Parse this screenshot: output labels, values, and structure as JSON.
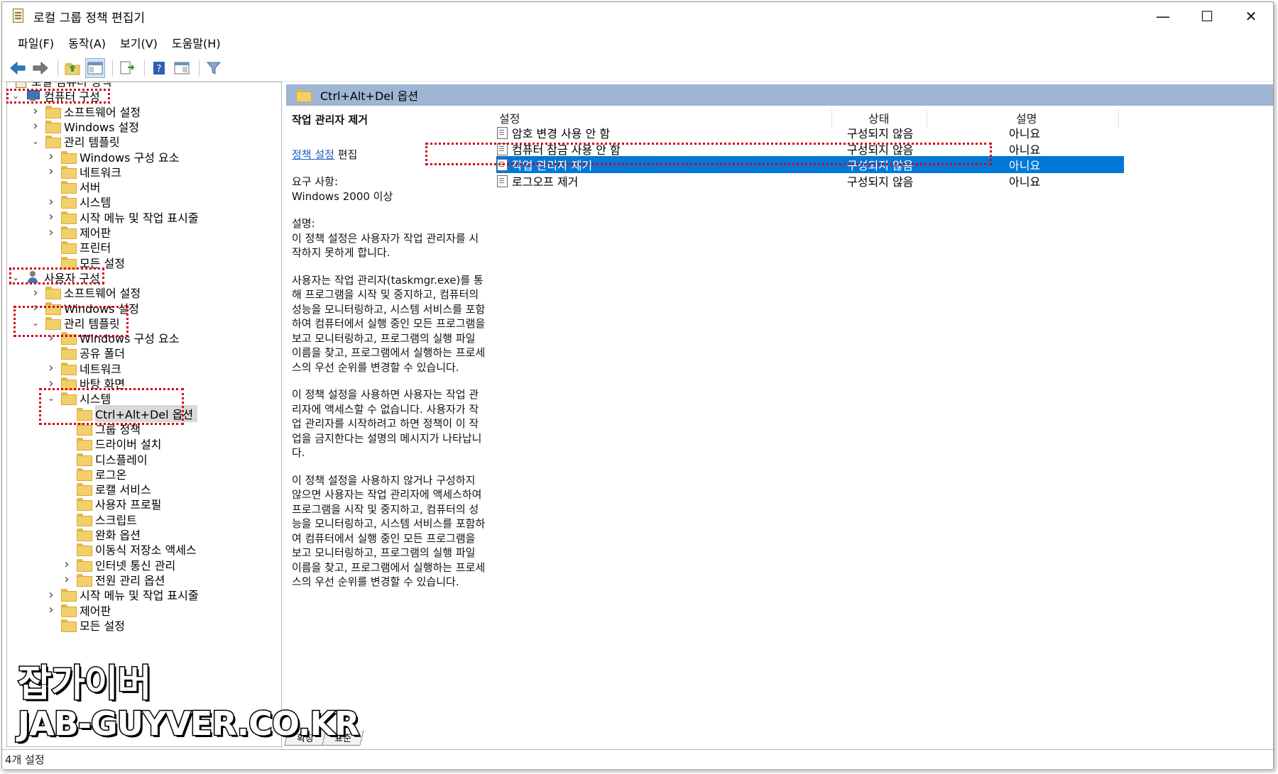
{
  "window": {
    "title": "로컬 그룹 정책 편집기",
    "controls": {
      "minimize": "—",
      "maximize": "☐",
      "close": "✕"
    }
  },
  "menu": [
    "파일(F)",
    "동작(A)",
    "보기(V)",
    "도움말(H)"
  ],
  "toolbar": {
    "icons": [
      "back-arrow-icon",
      "forward-arrow-icon",
      "up-folder-icon",
      "show-hide-tree-icon",
      "export-list-icon",
      "help-icon",
      "properties-icon",
      "filter-icon"
    ]
  },
  "tree": {
    "root": "로컬 컴퓨터 정책",
    "items": [
      "컴퓨터 구성",
      "소프트웨어 설정",
      "Windows 설정",
      "관리 템플릿",
      "Windows 구성 요소",
      "네트워크",
      "서버",
      "시스템",
      "시작 메뉴 및 작업 표시줄",
      "제어판",
      "프린터",
      "모든 설정",
      "사용자 구성",
      "소프트웨어 설정",
      "Windows 설정",
      "관리 템플릿",
      "Windows 구성 요소",
      "공유 폴더",
      "네트워크",
      "바탕 화면",
      "시스템",
      "Ctrl+Alt+Del 옵션",
      "그룹 정책",
      "드라이버 설치",
      "디스플레이",
      "로그온",
      "로캘 서비스",
      "사용자 프로필",
      "스크립트",
      "완화 옵션",
      "이동식 저장소 액세스",
      "인터넷 통신 관리",
      "전원 관리 옵션",
      "시작 메뉴 및 작업 표시줄",
      "제어판",
      "모든 설정"
    ]
  },
  "right": {
    "header": "Ctrl+Alt+Del 옵션",
    "description": {
      "title": "작업 관리자 제거",
      "link": "정책 설정",
      "link_suffix": " 편집",
      "req_label": "요구 사항:",
      "req_value": "Windows 2000 이상",
      "desc_label": "설명:",
      "paragraphs": [
        "이 정책 설정은 사용자가 작업 관리자를 시작하지 못하게 합니다.",
        "사용자는 작업 관리자(taskmgr.exe)를 통해 프로그램을 시작 및 중지하고, 컴퓨터의 성능을 모니터링하고, 시스템 서비스를 포함하여 컴퓨터에서 실행 중인 모든 프로그램을 보고 모니터링하고, 프로그램의 실행 파일 이름을 찾고, 프로그램에서 실행하는 프로세스의 우선 순위를 변경할 수 있습니다.",
        "이 정책 설정을 사용하면 사용자는 작업 관리자에 액세스할 수 없습니다. 사용자가 작업 관리자를 시작하려고 하면 정책이 이 작업을 금지한다는 설명의 메시지가 나타납니다.",
        "이 정책 설정을 사용하지 않거나 구성하지 않으면 사용자는 작업 관리자에 액세스하여 프로그램을 시작 및 중지하고, 컴퓨터의 성능을 모니터링하고, 시스템 서비스를 포함하여 컴퓨터에서 실행 중인 모든 프로그램을 보고 모니터링하고, 프로그램의 실행 파일 이름을 찾고, 프로그램에서 실행하는 프로세스의 우선 순위를 변경할 수 있습니다."
      ]
    },
    "columns": [
      "설정",
      "상태",
      "설명"
    ],
    "rows": [
      {
        "setting": "암호 변경 사용 안 함",
        "state": "구성되지 않음",
        "comment": "아니요"
      },
      {
        "setting": "컴퓨터 잠금 사용 안 함",
        "state": "구성되지 않음",
        "comment": "아니요"
      },
      {
        "setting": "작업 관리자 제거",
        "state": "구성되지 않음",
        "comment": "아니요"
      },
      {
        "setting": "로그오프 제거",
        "state": "구성되지 않음",
        "comment": "아니요"
      }
    ],
    "selected_row": 2,
    "tabs": [
      "확장",
      "표준"
    ]
  },
  "status": "4개 설정",
  "watermark": {
    "line1": "잡가이버",
    "line2": "JAB-GUYVER.CO.KR"
  },
  "colors": {
    "selection": "#0078d7",
    "header_band": "#9eb6d4",
    "highlight_box": "#d0021b",
    "link": "#1a5dc7"
  }
}
